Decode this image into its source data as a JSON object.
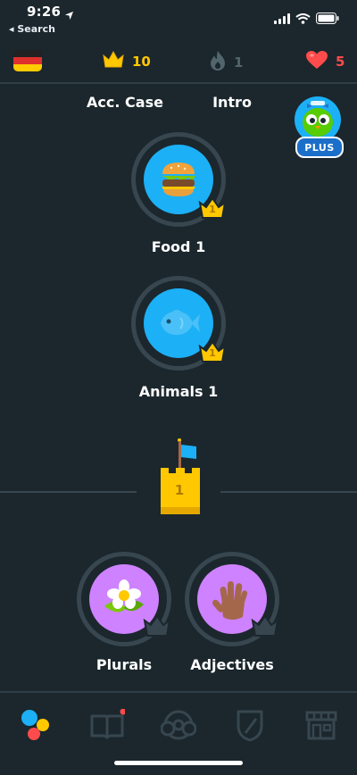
{
  "status_bar": {
    "time": "9:26",
    "back_label": "◂ Search"
  },
  "top_bar": {
    "language_flag": "germany-flag-icon",
    "crowns": "10",
    "streak": "1",
    "hearts": "5",
    "colors": {
      "crown": "#ffc800",
      "streak": "#52656d",
      "heart": "#ff4b4b"
    }
  },
  "header_labels": {
    "left": "Acc. Case",
    "right": "Intro"
  },
  "plus_badge": {
    "label": "PLUS"
  },
  "skills": [
    {
      "label": "Food 1",
      "crown_level": "1",
      "icon": "burger-icon",
      "color": "#1cb0f6"
    },
    {
      "label": "Animals 1",
      "crown_level": "1",
      "icon": "fish-icon",
      "color": "#1cb0f6"
    },
    {
      "label": "Plurals",
      "icon": "flower-icon",
      "color": "#ce82ff"
    },
    {
      "label": "Adjectives",
      "icon": "hand-icon",
      "color": "#ce82ff"
    }
  ],
  "checkpoint": {
    "level": "1"
  },
  "bottom_nav": [
    "learn-icon",
    "stories-icon",
    "leaderboard-icon",
    "shield-icon",
    "shop-icon"
  ],
  "colors": {
    "background": "#1b272d",
    "ring": "#37464f",
    "divider": "#2f3e47",
    "blue": "#1cb0f6",
    "purple": "#ce82ff",
    "gold": "#ffc800"
  }
}
